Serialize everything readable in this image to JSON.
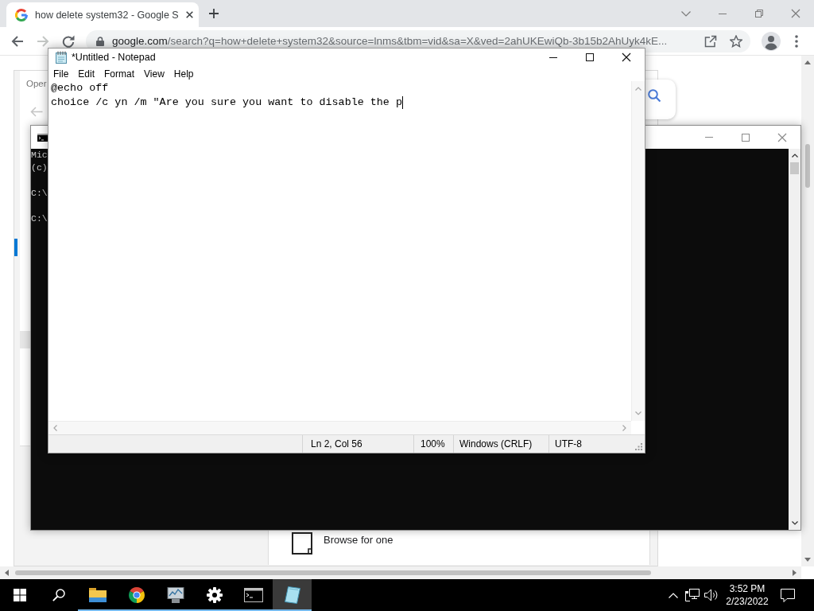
{
  "browser": {
    "tabs": [
      {
        "title": "how delete system32 - Google S",
        "selected": true
      }
    ],
    "nav": [
      {
        "kind": "back",
        "disabled": false
      },
      {
        "kind": "forward",
        "disabled": true
      },
      {
        "kind": "reload",
        "disabled": false
      }
    ],
    "address": {
      "host": "google.com",
      "path": "/search?q=how+delete+system32&source=lnms&tbm=vid&sa=X&ved=2ahUKEwiQb-3b15b2AhUyk4kE..."
    },
    "page": {
      "dialog_title": "Oper",
      "browse_label": "Browse for one"
    }
  },
  "console": {
    "blocks": [
      [
        "Mic",
        "(c)"
      ],
      [
        "C:\\"
      ],
      [
        "C:\\"
      ]
    ]
  },
  "notepad": {
    "title": "*Untitled - Notepad",
    "menu": [
      "File",
      "Edit",
      "Format",
      "View",
      "Help"
    ],
    "lines": [
      {
        "text": "@echo off",
        "cursor": false
      },
      {
        "text": "choice /c yn /m \"Are you sure you want to disable the p",
        "cursor": true
      }
    ],
    "status": {
      "position": "Ln 2, Col 56",
      "zoom": "100%",
      "line_ending": "Windows (CRLF)",
      "encoding": "UTF-8"
    }
  },
  "taskbar": {
    "apps": [
      {
        "kind": "explorer",
        "running": true,
        "selected": false
      },
      {
        "kind": "browser",
        "running": true,
        "selected": false
      },
      {
        "kind": "monitor",
        "running": true,
        "selected": false
      },
      {
        "kind": "settings",
        "running": true,
        "selected": false
      },
      {
        "kind": "terminal",
        "running": true,
        "selected": false
      },
      {
        "kind": "notepad",
        "running": true,
        "selected": true
      }
    ],
    "time": "3:52 PM",
    "date": "2/23/2022"
  }
}
